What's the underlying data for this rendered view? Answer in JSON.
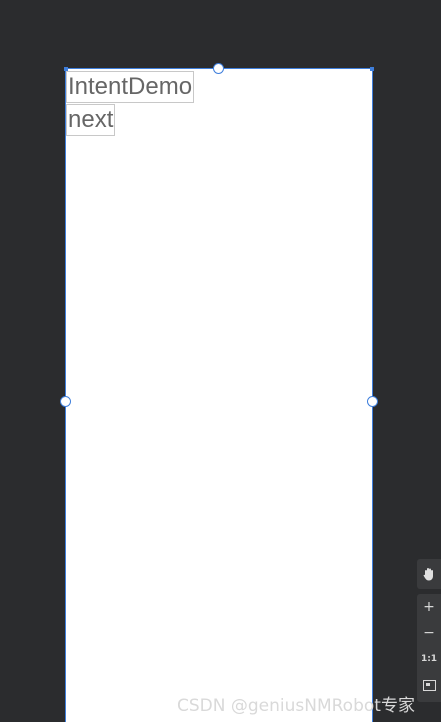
{
  "app": {
    "title_text": "IntentDemo",
    "button_text": "next"
  },
  "toolbar": {
    "pan_icon": "hand-icon",
    "zoom_in": "+",
    "zoom_out": "−",
    "actual_size": "1:1",
    "fit_icon": "fit-screen-icon"
  },
  "watermark": {
    "text": "CSDN @geniusNMRobot专家"
  },
  "colors": {
    "canvas_bg": "#2b2c2e",
    "selection": "#3f7fdc",
    "widget_text": "#666666"
  }
}
